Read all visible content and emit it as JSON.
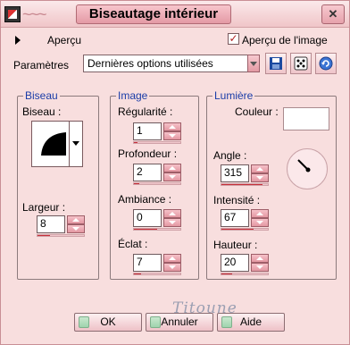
{
  "window": {
    "title": "Biseautage intérieur",
    "close_glyph": "✕",
    "title_flourish": "~~~",
    "accent": "#e49aa5"
  },
  "preview": {
    "label": "Aperçu",
    "checkbox_label": "Aperçu de l'image",
    "checked": true
  },
  "params": {
    "label": "Paramètres",
    "selected_preset": "Dernières options utilisées",
    "icons": [
      "save-preset-icon",
      "randomize-dice-icon",
      "reset-icon"
    ]
  },
  "bevel": {
    "group_title": "Biseau",
    "shape_label": "Biseau :",
    "width_label": "Largeur :",
    "width_value": "8"
  },
  "image": {
    "group_title": "Image",
    "smoothness_label": "Régularité :",
    "smoothness_value": "1",
    "depth_label": "Profondeur :",
    "depth_value": "2",
    "ambience_label": "Ambiance :",
    "ambience_value": "0",
    "shine_label": "Éclat :",
    "shine_value": "7"
  },
  "light": {
    "group_title": "Lumière",
    "color_label": "Couleur :",
    "color_value": "#ffffff",
    "angle_label": "Angle :",
    "angle_value": "315",
    "intensity_label": "Intensité :",
    "intensity_value": "67",
    "elevation_label": "Hauteur :",
    "elevation_value": "20"
  },
  "watermark": "Titoune",
  "buttons": {
    "ok": "OK",
    "cancel": "Annuler",
    "help": "Aide"
  }
}
